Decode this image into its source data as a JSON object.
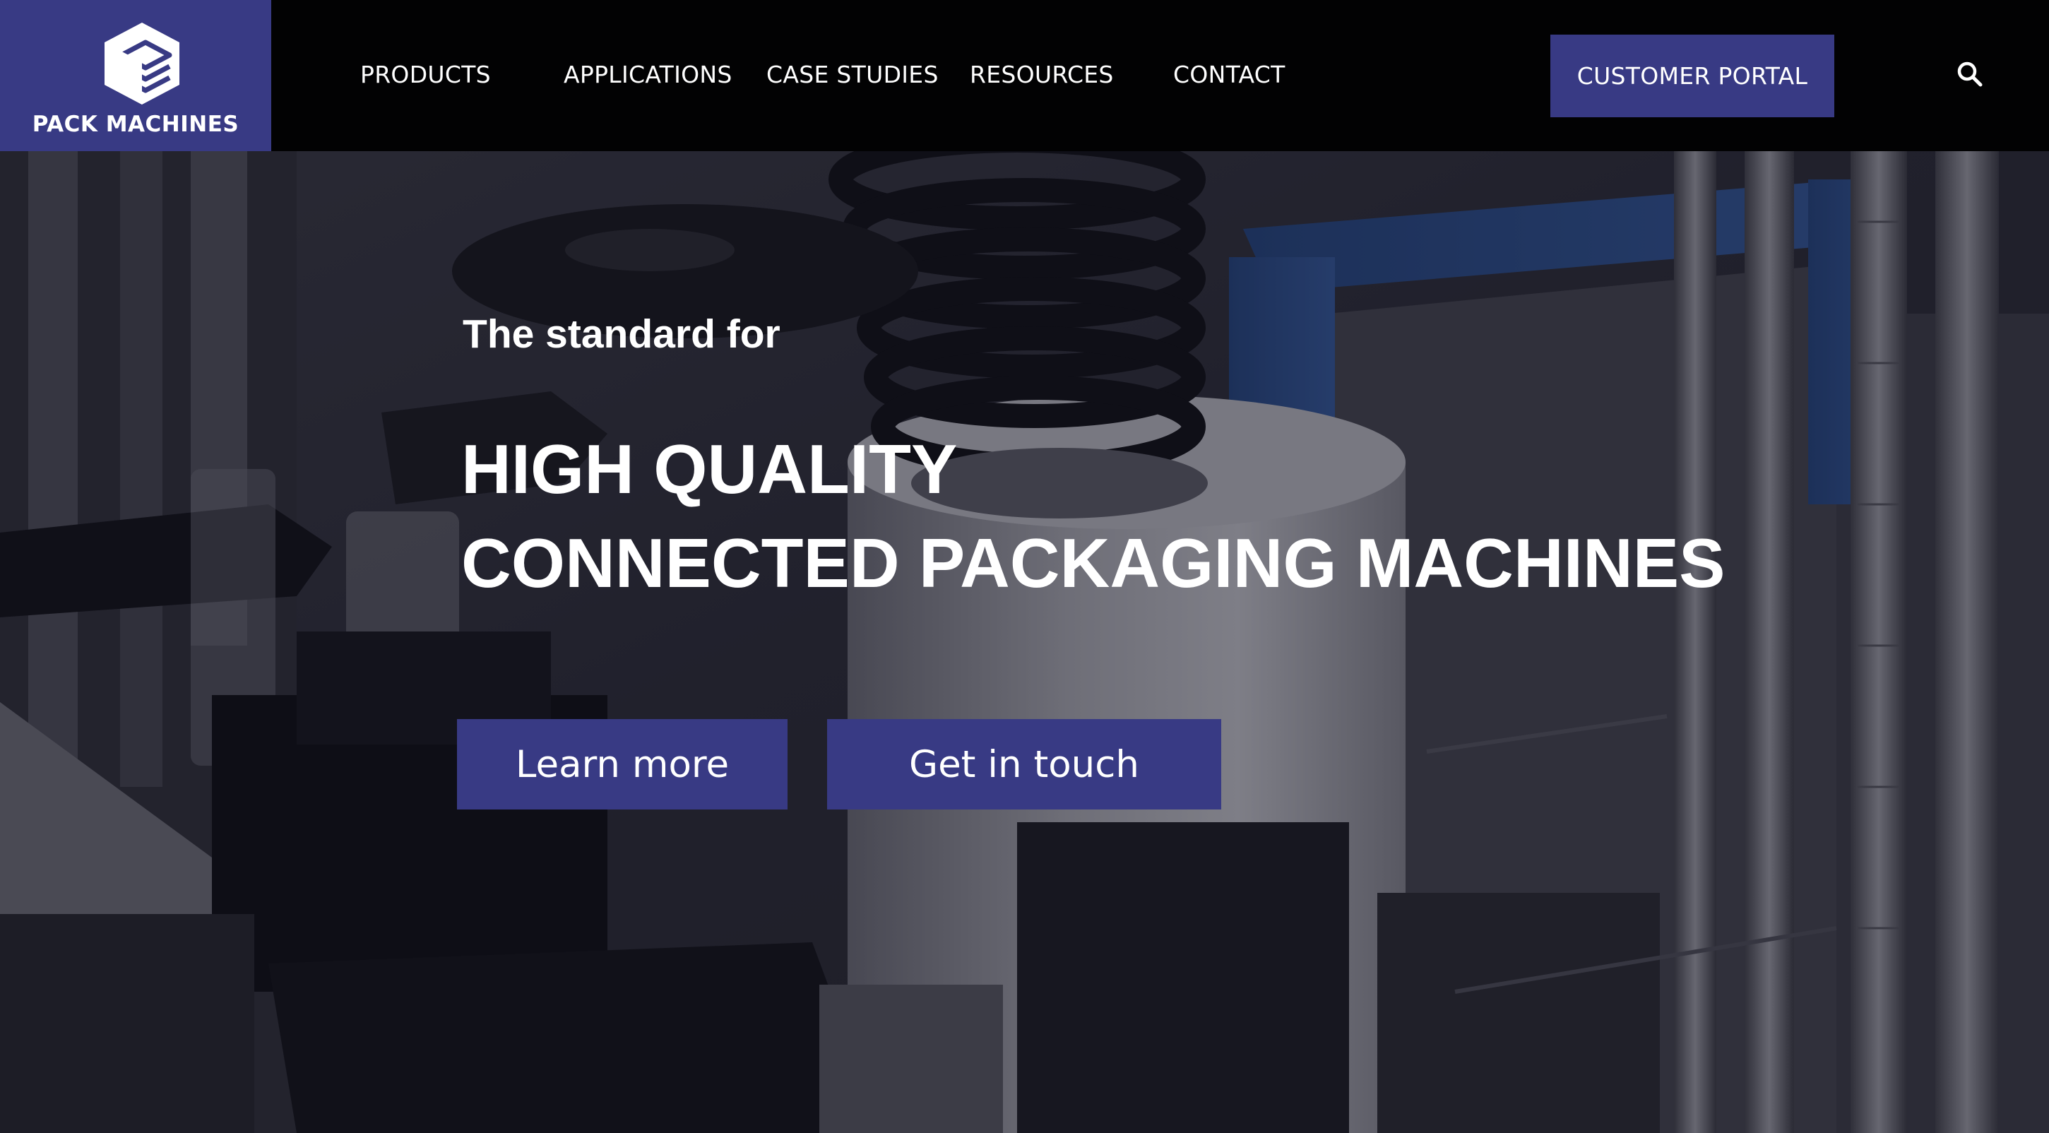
{
  "brand": {
    "name": "PACK MACHINES"
  },
  "nav": {
    "items": [
      {
        "label": "PRODUCTS"
      },
      {
        "label": "APPLICATIONS"
      },
      {
        "label": "CASE STUDIES"
      },
      {
        "label": "RESOURCES"
      },
      {
        "label": "CONTACT"
      }
    ],
    "portal_label": "CUSTOMER PORTAL",
    "search_icon": "search-icon"
  },
  "hero": {
    "eyebrow": "The standard for",
    "headline_line1": "HIGH QUALITY",
    "headline_line2": "CONNECTED PACKAGING MACHINES",
    "cta_primary": "Learn more",
    "cta_secondary": "Get in touch"
  },
  "colors": {
    "brand_navy": "#383a84",
    "header_bg": "#020203",
    "text": "#ffffff"
  }
}
